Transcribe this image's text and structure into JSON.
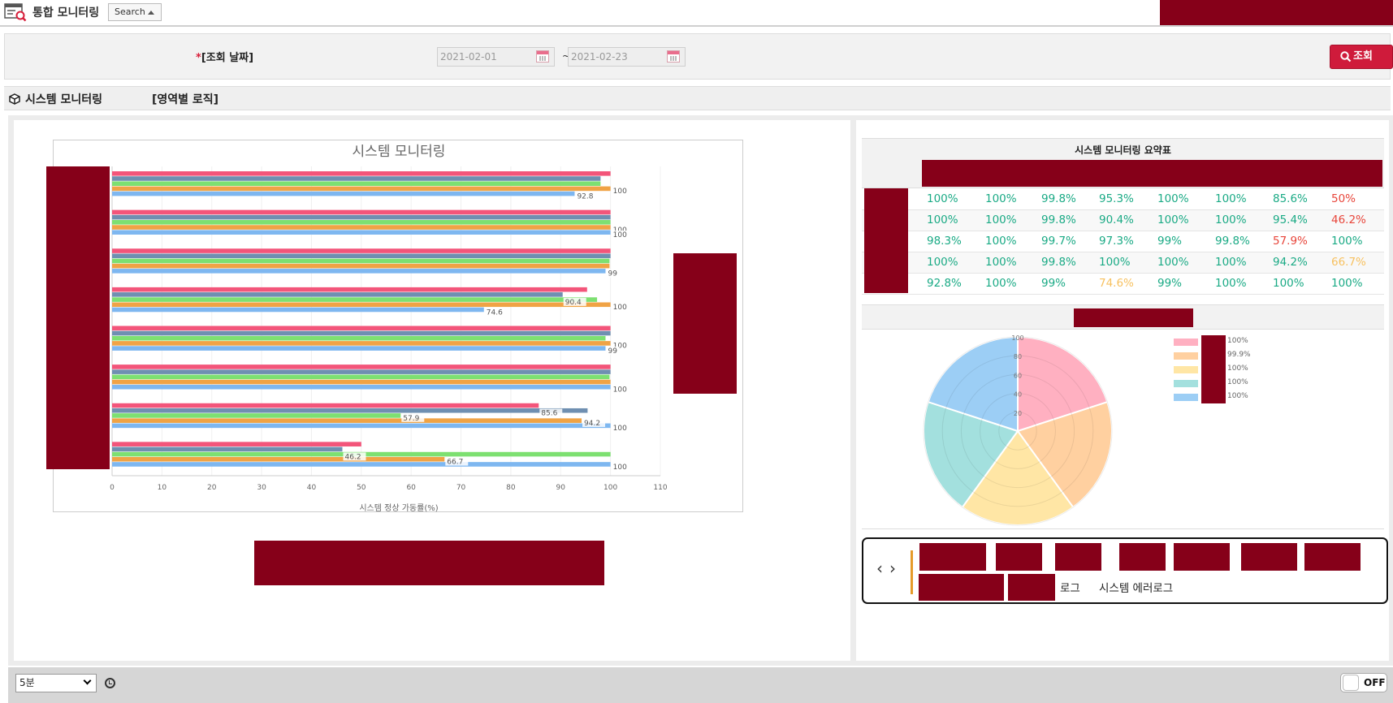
{
  "header": {
    "app_title": "통합 모니터링",
    "search_toggle": "Search"
  },
  "search": {
    "date_label_required": "*",
    "date_label": "[조회 날짜]",
    "start_date": "2021-02-01",
    "end_date": "2021-02-23",
    "separator": "~",
    "search_button": "조회"
  },
  "section": {
    "title": "시스템 모니터링",
    "subtitle": "[영역별 로직]"
  },
  "chart_data": {
    "type": "bar",
    "orientation": "horizontal",
    "title": "시스템 모니터링",
    "xlabel": "시스템 정상 가동률(%)",
    "xlim": [
      0,
      110
    ],
    "xticks": [
      "0",
      "10",
      "20",
      "30",
      "40",
      "50",
      "60",
      "70",
      "80",
      "90",
      "100",
      "110"
    ],
    "colors": [
      "#f3557a",
      "#6f8fb1",
      "#7de071",
      "#f0a345",
      "#7eb7f0"
    ],
    "groups": [
      {
        "values": [
          100,
          98,
          98,
          100,
          92.8
        ],
        "labels": [
          "100",
          "92.8"
        ]
      },
      {
        "values": [
          100,
          100,
          100,
          100,
          100
        ],
        "labels": [
          "100",
          "100"
        ]
      },
      {
        "values": [
          100,
          100,
          99.8,
          99.8,
          99
        ],
        "labels": [
          "99"
        ]
      },
      {
        "values": [
          95.3,
          90.4,
          97.3,
          100,
          74.6
        ],
        "labels": [
          "90.4",
          "100",
          "74.6"
        ]
      },
      {
        "values": [
          100,
          100,
          99,
          100,
          99
        ],
        "labels": [
          "100",
          "99"
        ]
      },
      {
        "values": [
          100,
          100,
          99.8,
          100,
          100
        ],
        "labels": [
          "100"
        ]
      },
      {
        "values": [
          85.6,
          95.4,
          57.9,
          94.2,
          100
        ],
        "labels": [
          "85.6",
          "57.9",
          "94.2",
          "100"
        ]
      },
      {
        "values": [
          50,
          46.2,
          100,
          66.7,
          100
        ],
        "labels": [
          "46.2",
          "66.7",
          "100"
        ]
      }
    ]
  },
  "summary": {
    "title": "시스템 모니터링 요약표",
    "rows": [
      [
        "100%",
        "100%",
        "99.8%",
        "95.3%",
        "100%",
        "100%",
        "85.6%",
        "50%"
      ],
      [
        "100%",
        "100%",
        "99.8%",
        "90.4%",
        "100%",
        "100%",
        "95.4%",
        "46.2%"
      ],
      [
        "98.3%",
        "100%",
        "99.7%",
        "97.3%",
        "99%",
        "99.8%",
        "57.9%",
        "100%"
      ],
      [
        "100%",
        "100%",
        "99.8%",
        "100%",
        "100%",
        "100%",
        "94.2%",
        "66.7%"
      ],
      [
        "92.8%",
        "100%",
        "99%",
        "74.6%",
        "99%",
        "100%",
        "100%",
        "100%"
      ]
    ],
    "cell_colors": [
      [
        "ok",
        "ok",
        "ok",
        "ok",
        "ok",
        "ok",
        "ok",
        "bad"
      ],
      [
        "ok",
        "ok",
        "ok",
        "ok",
        "ok",
        "ok",
        "ok",
        "bad"
      ],
      [
        "ok",
        "ok",
        "ok",
        "ok",
        "ok",
        "ok",
        "bad",
        "ok"
      ],
      [
        "ok",
        "ok",
        "ok",
        "ok",
        "ok",
        "ok",
        "ok",
        "warn"
      ],
      [
        "ok",
        "ok",
        "ok",
        "warn",
        "ok",
        "ok",
        "ok",
        "ok"
      ]
    ],
    "status_colors": {
      "ok": "#1aaa85",
      "bad": "#e8453a",
      "warn": "#f7c160"
    }
  },
  "polar": {
    "ticks": [
      "100",
      "80",
      "60",
      "40",
      "20"
    ],
    "slice_colors": [
      "#ffb0c1",
      "#ffd0a0",
      "#ffe6a5",
      "#a3e0de",
      "#9ccef5"
    ],
    "values": [
      100,
      100,
      100,
      100,
      100
    ],
    "legend": [
      {
        "color": "#ffb0c1",
        "value": "100%"
      },
      {
        "color": "#ffd0a0",
        "value": "99.9%"
      },
      {
        "color": "#ffe6a5",
        "value": "100%"
      },
      {
        "color": "#a3e0de",
        "value": "100%"
      },
      {
        "color": "#9ccef5",
        "value": "100%"
      }
    ]
  },
  "log_nav": {
    "partial_text": "로그",
    "error_log": "시스템 에러로그"
  },
  "footer": {
    "interval": "5분",
    "auto_refresh": "OFF"
  }
}
